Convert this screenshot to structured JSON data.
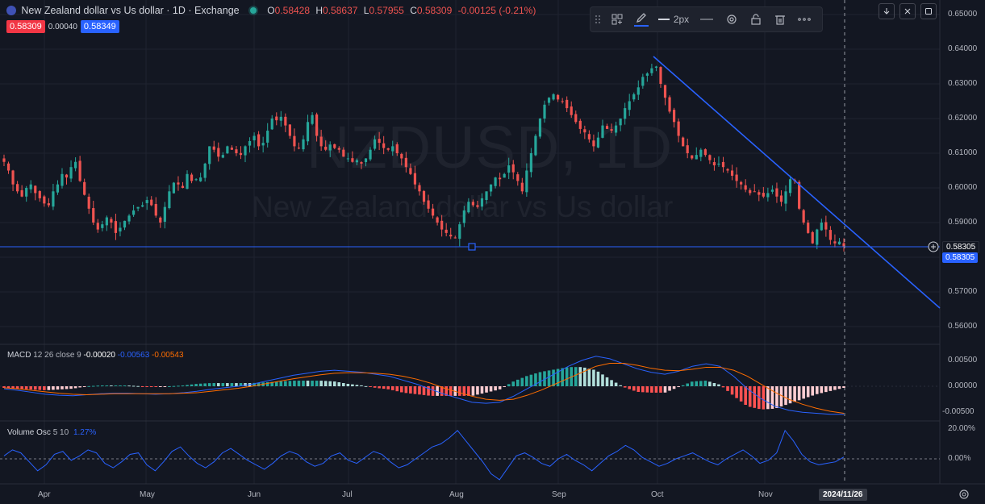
{
  "header": {
    "title": "New Zealand dollar vs Us dollar · 1D · Exchange",
    "ohlc": [
      {
        "k": "O",
        "v": "0.58428"
      },
      {
        "k": "H",
        "v": "0.58637"
      },
      {
        "k": "L",
        "v": "0.57955"
      },
      {
        "k": "C",
        "v": "0.58309"
      },
      {
        "k": "",
        "v": "-0.00125 (-0.21%)"
      }
    ],
    "bid": "0.58309",
    "spread": "0.00040",
    "ask": "0.58349",
    "colors": {
      "bid": "#f23645",
      "ask": "#2962ff",
      "up": "#26a69a",
      "down": "#ef5350"
    }
  },
  "watermark": {
    "symbol": "NZDUSD, 1D",
    "name": "New Zealand dollar vs Us dollar"
  },
  "toolbar": {
    "width_label": "2px",
    "icons": [
      "drag-handle-icon",
      "templates-icon",
      "pencil-icon",
      "line-width-icon",
      "line-style-icon",
      "gear-icon",
      "lock-icon",
      "trash-icon",
      "more-icon"
    ]
  },
  "price_axis": [
    "0.65000",
    "0.64000",
    "0.63000",
    "0.62000",
    "0.61000",
    "0.60000",
    "0.59000",
    "0.58000",
    "0.57000",
    "0.56000"
  ],
  "price_tags": {
    "line": "0.58305",
    "last": "0.58305"
  },
  "macd": {
    "label": "MACD",
    "params": "12 26 close 9",
    "hist": "-0.00020",
    "macd": "-0.00563",
    "signal": "-0.00543",
    "axis": [
      "0.00500",
      "0.00000",
      "-0.00500"
    ]
  },
  "volume_osc": {
    "label": "Volume Osc",
    "params": "5 10",
    "value": "1.27%",
    "axis": [
      "20.00%",
      "0.00%"
    ]
  },
  "time_axis": [
    "Apr",
    "May",
    "Jun",
    "Jul",
    "Aug",
    "Sep",
    "Oct",
    "Nov"
  ],
  "crosshair_date": "2024/11/26",
  "chart_data": {
    "type": "candlestick",
    "symbol": "NZDUSD",
    "timeframe": "1D",
    "ylim": [
      0.555,
      0.652
    ],
    "close": [
      0.6075,
      0.605,
      0.601,
      0.599,
      0.5975,
      0.6,
      0.601,
      0.5985,
      0.597,
      0.5955,
      0.595,
      0.599,
      0.601,
      0.604,
      0.603,
      0.606,
      0.6075,
      0.602,
      0.598,
      0.594,
      0.59,
      0.588,
      0.5895,
      0.5915,
      0.59,
      0.587,
      0.5885,
      0.5905,
      0.592,
      0.5935,
      0.5945,
      0.595,
      0.5965,
      0.595,
      0.592,
      0.59,
      0.5945,
      0.599,
      0.6015,
      0.601,
      0.6,
      0.604,
      0.602,
      0.6025,
      0.603,
      0.607,
      0.612,
      0.611,
      0.609,
      0.6095,
      0.612,
      0.611,
      0.61,
      0.6095,
      0.612,
      0.6135,
      0.615,
      0.612,
      0.613,
      0.6165,
      0.62,
      0.6195,
      0.6205,
      0.618,
      0.615,
      0.612,
      0.6115,
      0.614,
      0.619,
      0.621,
      0.615,
      0.612,
      0.611,
      0.6125,
      0.6115,
      0.611,
      0.609,
      0.6085,
      0.6075,
      0.608,
      0.607,
      0.6085,
      0.611,
      0.614,
      0.613,
      0.6115,
      0.611,
      0.612,
      0.61,
      0.6085,
      0.606,
      0.604,
      0.601,
      0.599,
      0.596,
      0.594,
      0.592,
      0.59,
      0.588,
      0.587,
      0.586,
      0.5855,
      0.5895,
      0.5935,
      0.596,
      0.595,
      0.5945,
      0.597,
      0.599,
      0.601,
      0.603,
      0.6025,
      0.604,
      0.6065,
      0.6045,
      0.602,
      0.599,
      0.605,
      0.61,
      0.615,
      0.62,
      0.624,
      0.626,
      0.627,
      0.6255,
      0.625,
      0.623,
      0.621,
      0.619,
      0.617,
      0.616,
      0.614,
      0.612,
      0.6145,
      0.618,
      0.617,
      0.6165,
      0.618,
      0.62,
      0.623,
      0.625,
      0.627,
      0.629,
      0.632,
      0.633,
      0.6345,
      0.635,
      0.63,
      0.626,
      0.622,
      0.619,
      0.615,
      0.612,
      0.61,
      0.6085,
      0.6095,
      0.611,
      0.6095,
      0.608,
      0.6065,
      0.607,
      0.606,
      0.605,
      0.6035,
      0.602,
      0.601,
      0.5995,
      0.5985,
      0.599,
      0.598,
      0.5975,
      0.5985,
      0.5995,
      0.5975,
      0.596,
      0.599,
      0.6025,
      0.602,
      0.594,
      0.59,
      0.587,
      0.584,
      0.588,
      0.59,
      0.588,
      0.585,
      0.584,
      0.5845,
      0.5831
    ],
    "macd_line": [
      -0.0005,
      -0.0008,
      -0.0012,
      -0.0016,
      -0.0018,
      -0.0019,
      -0.0017,
      -0.0015,
      -0.0014,
      -0.0014,
      -0.0015,
      -0.0016,
      -0.0015,
      -0.0013,
      -0.001,
      -0.0006,
      -0.0003,
      0.0,
      0.0004,
      0.001,
      0.0016,
      0.0022,
      0.0026,
      0.003,
      0.0032,
      0.003,
      0.0028,
      0.0024,
      0.002,
      0.0012,
      0.0004,
      -0.0006,
      -0.0016,
      -0.0024,
      -0.0032,
      -0.0034,
      -0.0032,
      -0.002,
      -0.0005,
      0.001,
      0.0025,
      0.004,
      0.0052,
      0.006,
      0.0055,
      0.0045,
      0.0035,
      0.0028,
      0.0024,
      0.003,
      0.004,
      0.0045,
      0.004,
      0.002,
      -0.0005,
      -0.0025,
      -0.004,
      -0.0048,
      -0.0052,
      -0.0054,
      -0.0056,
      -0.0056
    ],
    "signal_line": [
      -0.0003,
      -0.0005,
      -0.0008,
      -0.0011,
      -0.0014,
      -0.0016,
      -0.0017,
      -0.0016,
      -0.0015,
      -0.0015,
      -0.0015,
      -0.0015,
      -0.0015,
      -0.0014,
      -0.0013,
      -0.001,
      -0.0007,
      -0.0004,
      0.0,
      0.0005,
      0.001,
      0.0015,
      0.0019,
      0.0023,
      0.0026,
      0.0027,
      0.0027,
      0.0026,
      0.0024,
      0.002,
      0.0014,
      0.0006,
      -0.0004,
      -0.0012,
      -0.002,
      -0.0026,
      -0.0028,
      -0.0026,
      -0.0018,
      -0.0008,
      0.0004,
      0.0016,
      0.0028,
      0.004,
      0.0046,
      0.0046,
      0.0042,
      0.0036,
      0.0032,
      0.0031,
      0.0034,
      0.0038,
      0.0038,
      0.0032,
      0.002,
      0.0004,
      -0.0012,
      -0.0026,
      -0.0036,
      -0.0044,
      -0.005,
      -0.0054
    ],
    "volume_osc": [
      2,
      6,
      4,
      -2,
      -8,
      -4,
      3,
      5,
      -1,
      2,
      6,
      4,
      -3,
      -6,
      -2,
      3,
      4,
      -4,
      -8,
      -2,
      5,
      8,
      2,
      -3,
      -6,
      -2,
      4,
      7,
      3,
      -1,
      -4,
      -7,
      -3,
      2,
      5,
      3,
      -2,
      -5,
      -3,
      2,
      4,
      -1,
      -3,
      1,
      5,
      3,
      -2,
      -6,
      -4,
      0,
      4,
      8,
      10,
      14,
      19,
      12,
      5,
      -2,
      -10,
      -14,
      -6,
      2,
      4,
      1,
      -3,
      -5,
      0,
      3,
      -1,
      -4,
      -8,
      -3,
      2,
      5,
      9,
      6,
      1,
      -2,
      -5,
      -3,
      0,
      2,
      4,
      1,
      -2,
      -4,
      0,
      3,
      6,
      2,
      -3,
      -1,
      4,
      19,
      12,
      3,
      -2,
      -4,
      -3,
      -2,
      1.27
    ]
  }
}
